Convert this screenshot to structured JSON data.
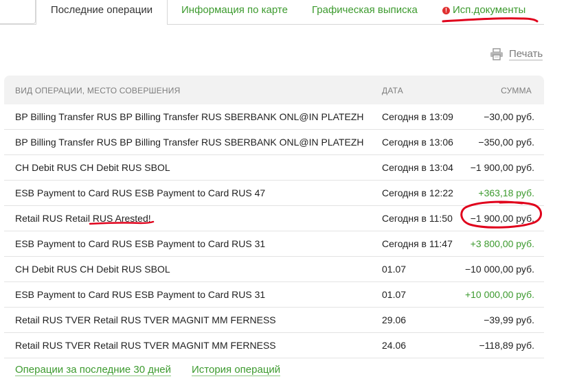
{
  "tabs": {
    "recent": "Последние операции",
    "card_info": "Информация по карте",
    "graphic_statement": "Графическая выписка",
    "docs": "Исп.документы",
    "docs_alert_icon": "exclamation-circle"
  },
  "print": {
    "label": "Печать",
    "icon": "printer-icon"
  },
  "table": {
    "headers": {
      "operation": "ВИД ОПЕРАЦИИ, МЕСТО СОВЕРШЕНИЯ",
      "date": "ДАТА",
      "sum": "СУММА"
    },
    "rows": [
      {
        "operation": "BP Billing Transfer RUS BP Billing Transfer RUS SBERBANK ONL@IN PLATEZH",
        "date": "Сегодня в 13:09",
        "sum": "−30,00 руб.",
        "type": "debit"
      },
      {
        "operation": "BP Billing Transfer RUS BP Billing Transfer RUS SBERBANK ONL@IN PLATEZH",
        "date": "Сегодня в 13:06",
        "sum": "−350,00 руб.",
        "type": "debit"
      },
      {
        "operation": "CH Debit RUS CH Debit RUS SBOL",
        "date": "Сегодня в 13:04",
        "sum": "−1 900,00 руб.",
        "type": "debit"
      },
      {
        "operation": "ESB Payment to Card RUS ESB Payment to Card RUS 47",
        "date": "Сегодня в 12:22",
        "sum": "+363,18 руб.",
        "type": "credit"
      },
      {
        "operation": "Retail RUS Retail RUS Arested!",
        "date": "Сегодня в 11:50",
        "sum": "−1 900,00 руб.",
        "type": "debit"
      },
      {
        "operation": "ESB Payment to Card RUS ESB Payment to Card RUS 31",
        "date": "Сегодня в 11:47",
        "sum": "+3 800,00 руб.",
        "type": "credit"
      },
      {
        "operation": "CH Debit RUS CH Debit RUS SBOL",
        "date": "01.07",
        "sum": "−10 000,00 руб.",
        "type": "debit"
      },
      {
        "operation": "ESB Payment to Card RUS ESB Payment to Card RUS 31",
        "date": "01.07",
        "sum": "+10 000,00 руб.",
        "type": "credit"
      },
      {
        "operation": "Retail RUS TVER Retail RUS TVER MAGNIT MM FERNESS",
        "date": "29.06",
        "sum": "−39,99 руб.",
        "type": "debit"
      },
      {
        "operation": "Retail RUS TVER Retail RUS TVER MAGNIT MM FERNESS",
        "date": "24.06",
        "sum": "−118,89 руб.",
        "type": "debit"
      }
    ]
  },
  "links": {
    "last_30_days": "Операции за последние 30 дней",
    "history": "История операций"
  },
  "colors": {
    "link_green": "#3c9a2e",
    "annotation_red": "#e0001b",
    "alert_red": "#e03030"
  }
}
